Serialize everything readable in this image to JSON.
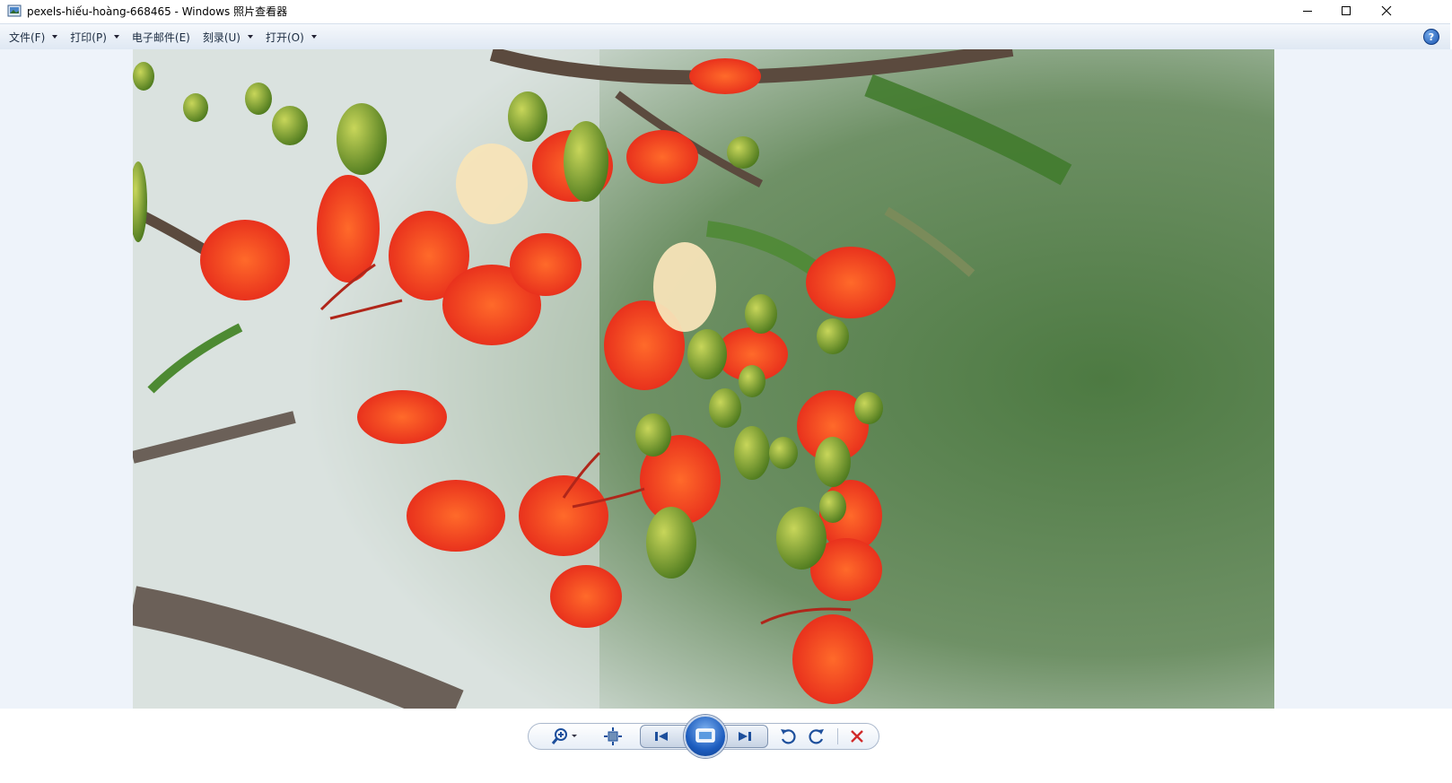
{
  "window": {
    "title": "pexels-hiếu-hoàng-668465 - Windows 照片查看器",
    "icon": "photo-viewer-app-icon",
    "controls": [
      "minimize-icon",
      "maximize-icon",
      "close-icon"
    ]
  },
  "menu": {
    "items": [
      {
        "label": "文件(F)",
        "has_dropdown": true
      },
      {
        "label": "打印(P)",
        "has_dropdown": true
      },
      {
        "label": "电子邮件(E)",
        "has_dropdown": false
      },
      {
        "label": "刻录(U)",
        "has_dropdown": true
      },
      {
        "label": "打开(O)",
        "has_dropdown": true
      }
    ],
    "help_icon": "help-icon",
    "help_label": "?"
  },
  "image": {
    "subject": "red-orange flame tree flowers with green buds and branches",
    "colors": {
      "petals": "#f0401c",
      "buds": "#7ea02a",
      "background_green": "#567f46",
      "background_light": "#dfe6e8"
    }
  },
  "toolbar": {
    "buttons": [
      {
        "name": "zoom-icon"
      },
      {
        "name": "actual-size-icon"
      },
      {
        "name": "previous-icon"
      },
      {
        "name": "slideshow-icon"
      },
      {
        "name": "next-icon"
      },
      {
        "name": "rotate-counterclockwise-icon"
      },
      {
        "name": "rotate-clockwise-icon"
      },
      {
        "name": "delete-icon"
      }
    ],
    "colors": {
      "accent": "#1d5dbf",
      "delete": "#d12a2a"
    }
  }
}
